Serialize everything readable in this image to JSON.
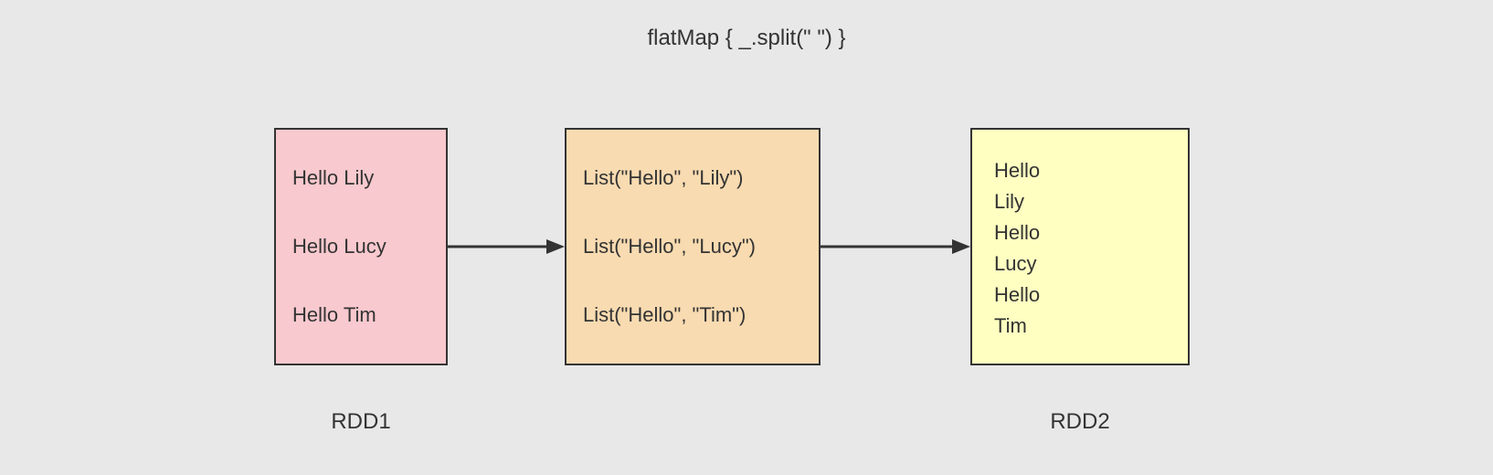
{
  "title": "flatMap { _.split(\" \") }",
  "box1": {
    "label": "RDD1",
    "items": [
      "Hello Lily",
      "Hello Lucy",
      "Hello Tim"
    ],
    "color": "#f8c9ce"
  },
  "box2": {
    "items": [
      "List(\"Hello\", \"Lily\")",
      "List(\"Hello\", \"Lucy\")",
      "List(\"Hello\", \"Tim\")"
    ],
    "color": "#f9dbb1"
  },
  "box3": {
    "label": "RDD2",
    "items": [
      "Hello",
      "Lily",
      "Hello",
      "Lucy",
      "Hello",
      "Tim"
    ],
    "color": "#feffc1"
  }
}
